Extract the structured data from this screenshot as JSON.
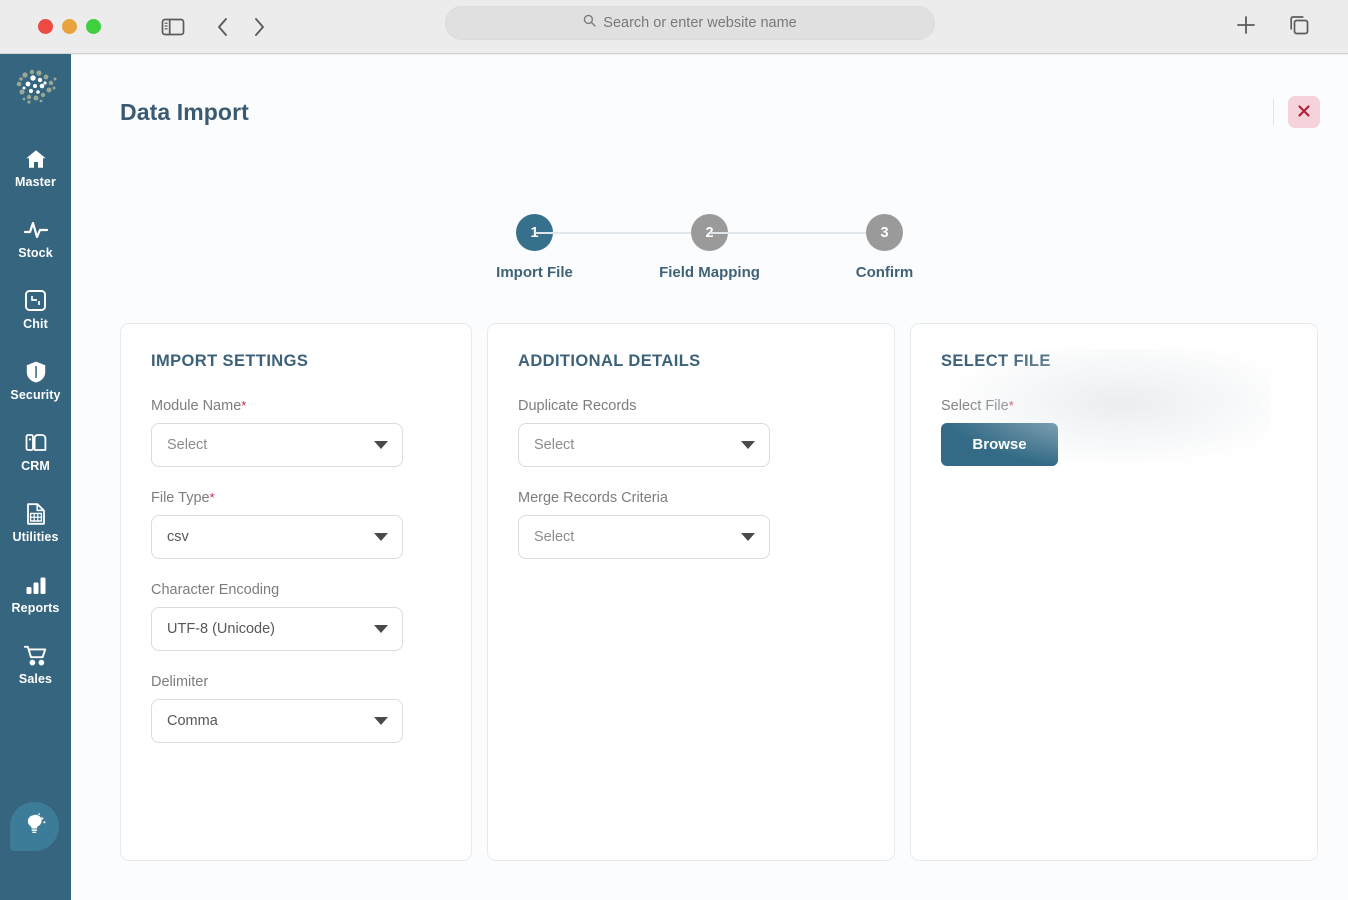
{
  "browser": {
    "address_bar": {
      "placeholder": "Search or enter website name",
      "value": ""
    },
    "icons": {
      "sidebar_toggle": "sidebar-toggle-icon",
      "back": "chevron-left-icon",
      "forward": "chevron-right-icon",
      "search": "search-icon",
      "new_tab": "plus-icon",
      "tab_overview": "tab-overview-icon"
    },
    "window_controls": [
      "close",
      "minimize",
      "maximize"
    ]
  },
  "sidebar": {
    "logo_name": "brain-logo",
    "items": [
      {
        "label": "Master",
        "icon": "home-icon"
      },
      {
        "label": "Stock",
        "icon": "pulse-icon"
      },
      {
        "label": "Chit",
        "icon": "scan-frame-icon"
      },
      {
        "label": "Security",
        "icon": "shield-icon"
      },
      {
        "label": "CRM",
        "icon": "crm-icon"
      },
      {
        "label": "Utilities",
        "icon": "grid-document-icon"
      },
      {
        "label": "Reports",
        "icon": "bar-chart-icon"
      },
      {
        "label": "Sales",
        "icon": "shopping-cart-icon"
      }
    ],
    "help_fab": {
      "icon": "lightbulb-icon",
      "label": ""
    },
    "background_color": "#36657f"
  },
  "header": {
    "title": "Data Import",
    "close_label": "×"
  },
  "stepper": {
    "active_step": 1,
    "steps": [
      {
        "number": "1",
        "label": "Import File",
        "state": "active"
      },
      {
        "number": "2",
        "label": "Field Mapping",
        "state": "idle"
      },
      {
        "number": "3",
        "label": "Confirm",
        "state": "idle"
      }
    ],
    "active_color": "#36708d",
    "idle_color": "#9a9a9a"
  },
  "cards": {
    "import_settings": {
      "title": "IMPORT SETTINGS",
      "fields": [
        {
          "label": "Module Name",
          "required": true,
          "value": "Select",
          "placeholder": "Select",
          "filled": false
        },
        {
          "label": "File Type",
          "required": true,
          "value": "csv",
          "placeholder": "Select",
          "filled": true
        },
        {
          "label": "Character Encoding",
          "required": false,
          "value": "UTF-8 (Unicode)",
          "placeholder": "Select",
          "filled": true
        },
        {
          "label": "Delimiter",
          "required": false,
          "value": "Comma",
          "placeholder": "Select",
          "filled": true
        }
      ]
    },
    "additional_details": {
      "title": "ADDITIONAL DETAILS",
      "fields": [
        {
          "label": "Duplicate Records",
          "required": false,
          "value": "Select",
          "placeholder": "Select",
          "filled": false
        },
        {
          "label": "Merge Records Criteria",
          "required": false,
          "value": "Select",
          "placeholder": "Select",
          "filled": false
        }
      ]
    },
    "select_file": {
      "title": "SELECT FILE",
      "field_label": "Select File",
      "required": true,
      "browse_label": "Browse",
      "browse_color": "#336b86"
    }
  },
  "colors": {
    "accent": "#36708d",
    "title_text": "#3a5a72",
    "page_background": "#fbfcfd",
    "required_marker": "#c62b47",
    "close_button_bg": "#f6d3da"
  }
}
